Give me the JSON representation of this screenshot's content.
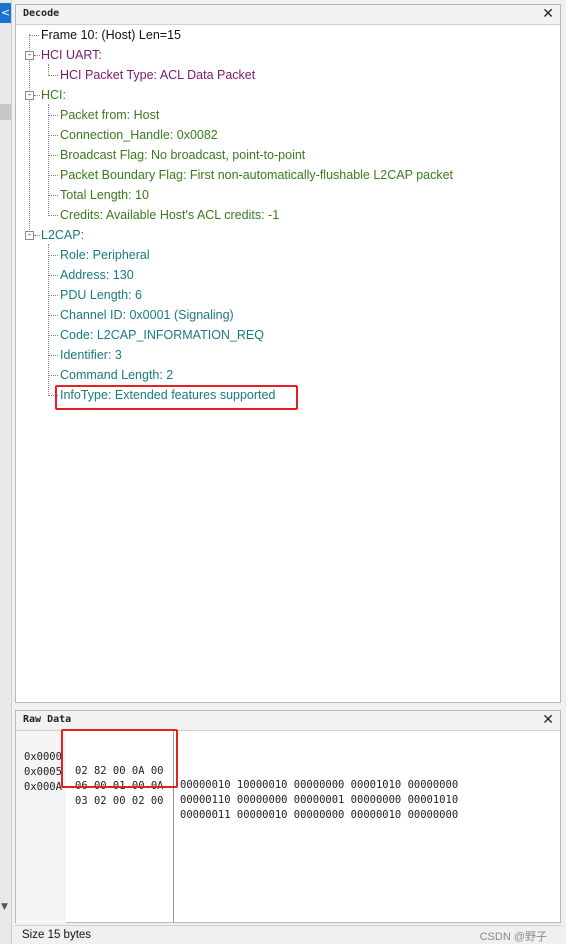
{
  "decode_panel": {
    "title": "Decode",
    "close": "✕",
    "frame": "Frame 10: (Host) Len=15",
    "hci_uart": {
      "label": "HCI UART:",
      "children": [
        "HCI Packet Type: ACL Data Packet"
      ]
    },
    "hci": {
      "label": "HCI:",
      "children": [
        "Packet from: Host",
        "Connection_Handle: 0x0082",
        "Broadcast Flag: No broadcast, point-to-point",
        "Packet Boundary Flag: First non-automatically-flushable L2CAP packet",
        "Total Length: 10",
        "Credits: Available Host's ACL credits: -1"
      ]
    },
    "l2cap": {
      "label": "L2CAP:",
      "children": [
        "Role: Peripheral",
        "Address: 130",
        "PDU Length: 6",
        "Channel ID: 0x0001  (Signaling)",
        "Code: L2CAP_INFORMATION_REQ",
        "Identifier: 3",
        "Command Length: 2",
        "InfoType: Extended features supported"
      ]
    },
    "collapse_glyph": "-"
  },
  "raw_panel": {
    "title": "Raw Data",
    "close": "✕",
    "rows": [
      {
        "offset": "0x0000",
        "hex": "02 82 00 0A 00",
        "bin": "00000010 10000010 00000000 00001010 00000000"
      },
      {
        "offset": "0x0005",
        "hex": "06 00 01 00 0A",
        "bin": "00000110 00000000 00000001 00000000 00001010"
      },
      {
        "offset": "0x000A",
        "hex": "03 02 00 02 00",
        "bin": "00000011 00000010 00000000 00000010 00000000"
      }
    ]
  },
  "status": {
    "size_text": "Size 15 bytes",
    "credit": "CSDN @野子"
  },
  "icons": {
    "left_arrow": "<",
    "left_down": "▼"
  },
  "colors": {
    "hci_uart": "#7b1a6e",
    "hci": "#3a7a1e",
    "l2cap": "#1a7a80",
    "highlight": "#e62020",
    "nav_accent": "#1874d0"
  }
}
